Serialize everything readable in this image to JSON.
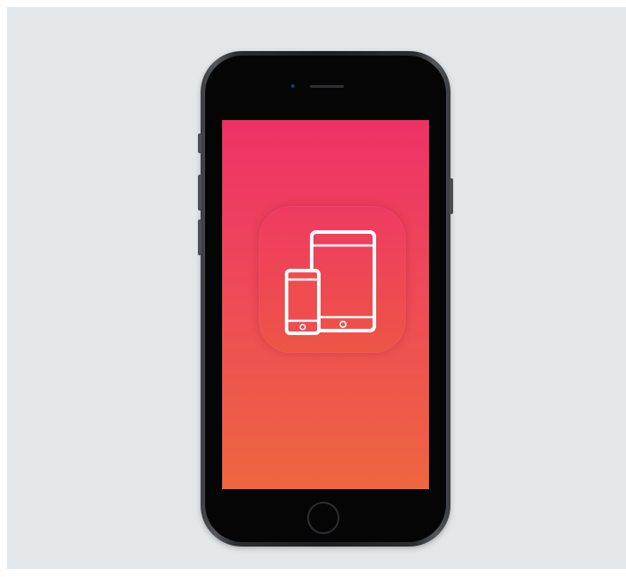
{
  "icons": {
    "app_icon": "devices-icon",
    "tablet": "tablet-icon",
    "phone": "phone-icon",
    "home_button": "home-button-icon"
  },
  "colors": {
    "background": "#e3e7ea",
    "screen_top": "#ef3167",
    "screen_bottom": "#ee663f",
    "phone_body": "#1e1f22",
    "icon_glyph": "#ffffff"
  }
}
